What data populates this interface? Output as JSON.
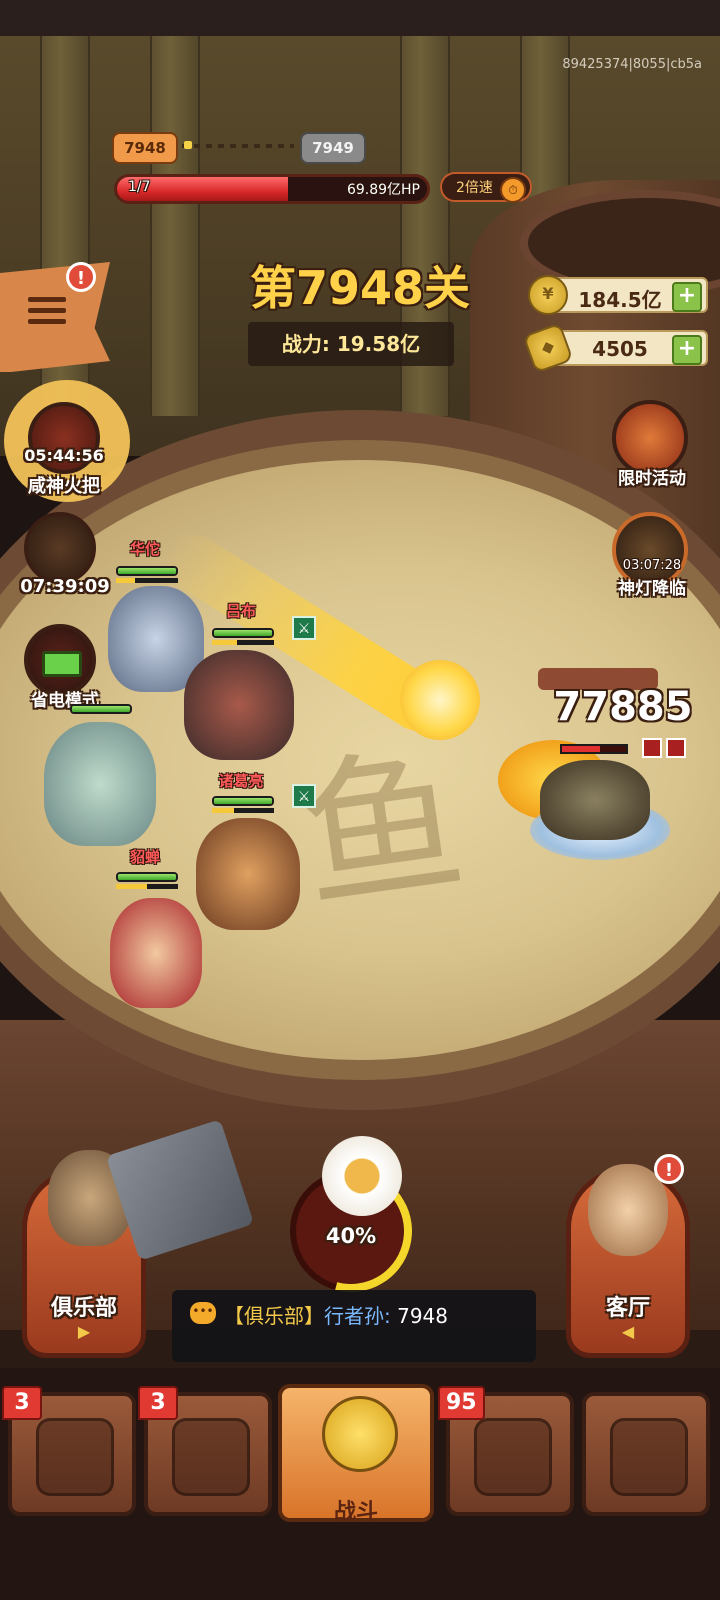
{
  "build_id": "89425374|8055|cb5a",
  "level": {
    "current": "7948",
    "next": "7949"
  },
  "boss_hp": {
    "count": "1/7",
    "value": "69.89亿HP",
    "fill_fraction": 0.55
  },
  "speed_button": {
    "label": "2倍速"
  },
  "stage_title": "第7948关",
  "power": {
    "label": "战力:",
    "value": "19.58亿"
  },
  "currencies": {
    "coins": "184.5亿",
    "ingots": "4505",
    "plus": "+"
  },
  "side_left": {
    "menu_alert": "!",
    "torch": {
      "timer": "05:44:56",
      "label": "咸神火把"
    },
    "book": {
      "timer": "07:39:09"
    },
    "battery": {
      "label": "省电模式"
    }
  },
  "side_right": {
    "timed_event": {
      "label": "限时活动"
    },
    "lamp": {
      "timer": "03:07:28",
      "label": "神灯降临"
    }
  },
  "heroes": [
    {
      "name": "华佗",
      "hp_fraction": 1.0
    },
    {
      "name": "吕布",
      "hp_fraction": 1.0
    },
    {
      "name": "诸葛亮",
      "hp_fraction": 1.0
    },
    {
      "name": "貂蝉",
      "hp_fraction": 1.0
    }
  ],
  "battle": {
    "damage": "77885",
    "floor_glyph": "鱼"
  },
  "buildings": {
    "club": "俱乐部",
    "hall": "客厅",
    "hall_alert": "!"
  },
  "pot": {
    "percent": "40%",
    "fraction": 0.4
  },
  "chat": {
    "channel": "【俱乐部】",
    "user": "行者孙:",
    "message": "7948"
  },
  "nav": {
    "badges": [
      "3",
      "3",
      "95"
    ],
    "battle_label": "战斗"
  },
  "colors": {
    "gold_title": "#ffd24a",
    "hp_red": "#d92a2a",
    "accent_orange": "#d8742a",
    "hero_name": "#ff5a5a"
  },
  "icons": [
    "menu-icon",
    "coin-icon",
    "ingot-icon",
    "torch-icon",
    "book-icon",
    "battery-icon",
    "stopwatch-icon",
    "genie-lamp-icon",
    "chat-bubble-icon",
    "sword-icon",
    "owl-icon",
    "kid-icon",
    "flower-pot-icon",
    "helmet-icon",
    "armor-icon",
    "battle-fist-icon",
    "chest-icon",
    "scroll-icon"
  ]
}
